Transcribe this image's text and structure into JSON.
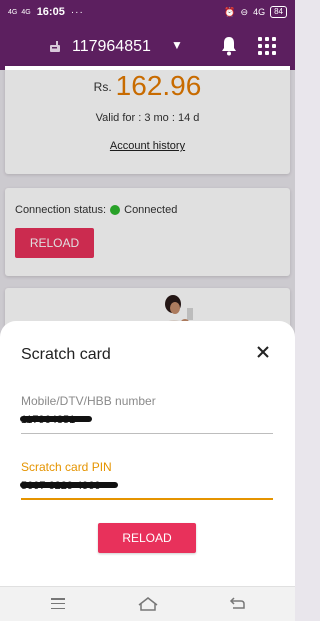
{
  "status_bar": {
    "signal_1": "4G",
    "signal_2": "4G",
    "time": "16:05",
    "more": "···",
    "net": "4G",
    "battery": "84"
  },
  "app_bar": {
    "account_number": "117964851",
    "icons": [
      "menu-icon",
      "phone-icon",
      "chevron-down-icon",
      "bell-icon",
      "apps-grid-icon"
    ]
  },
  "balance": {
    "currency": "Rs.",
    "amount": "162.96",
    "valid_for": "Valid for : 3 mo : 14 d",
    "history_link": "Account history"
  },
  "connection": {
    "label": "Connection status:",
    "value": "Connected",
    "status_color": "#2eb82e",
    "reload_label": "RELOAD"
  },
  "dialog": {
    "title": "Scratch card",
    "mobile_label": "Mobile/DTV/HBB number",
    "mobile_value": "117964851",
    "pin_label": "Scratch card PIN",
    "pin_value": "5007 6229 4960",
    "reload_label": "RELOAD"
  },
  "colors": {
    "brand": "#5c1f5f",
    "accent": "#e8315b",
    "amount": "#e47a00",
    "focus": "#e59400"
  },
  "nav_bar": {
    "icons": [
      "recent-apps-icon",
      "home-icon",
      "back-icon"
    ]
  }
}
